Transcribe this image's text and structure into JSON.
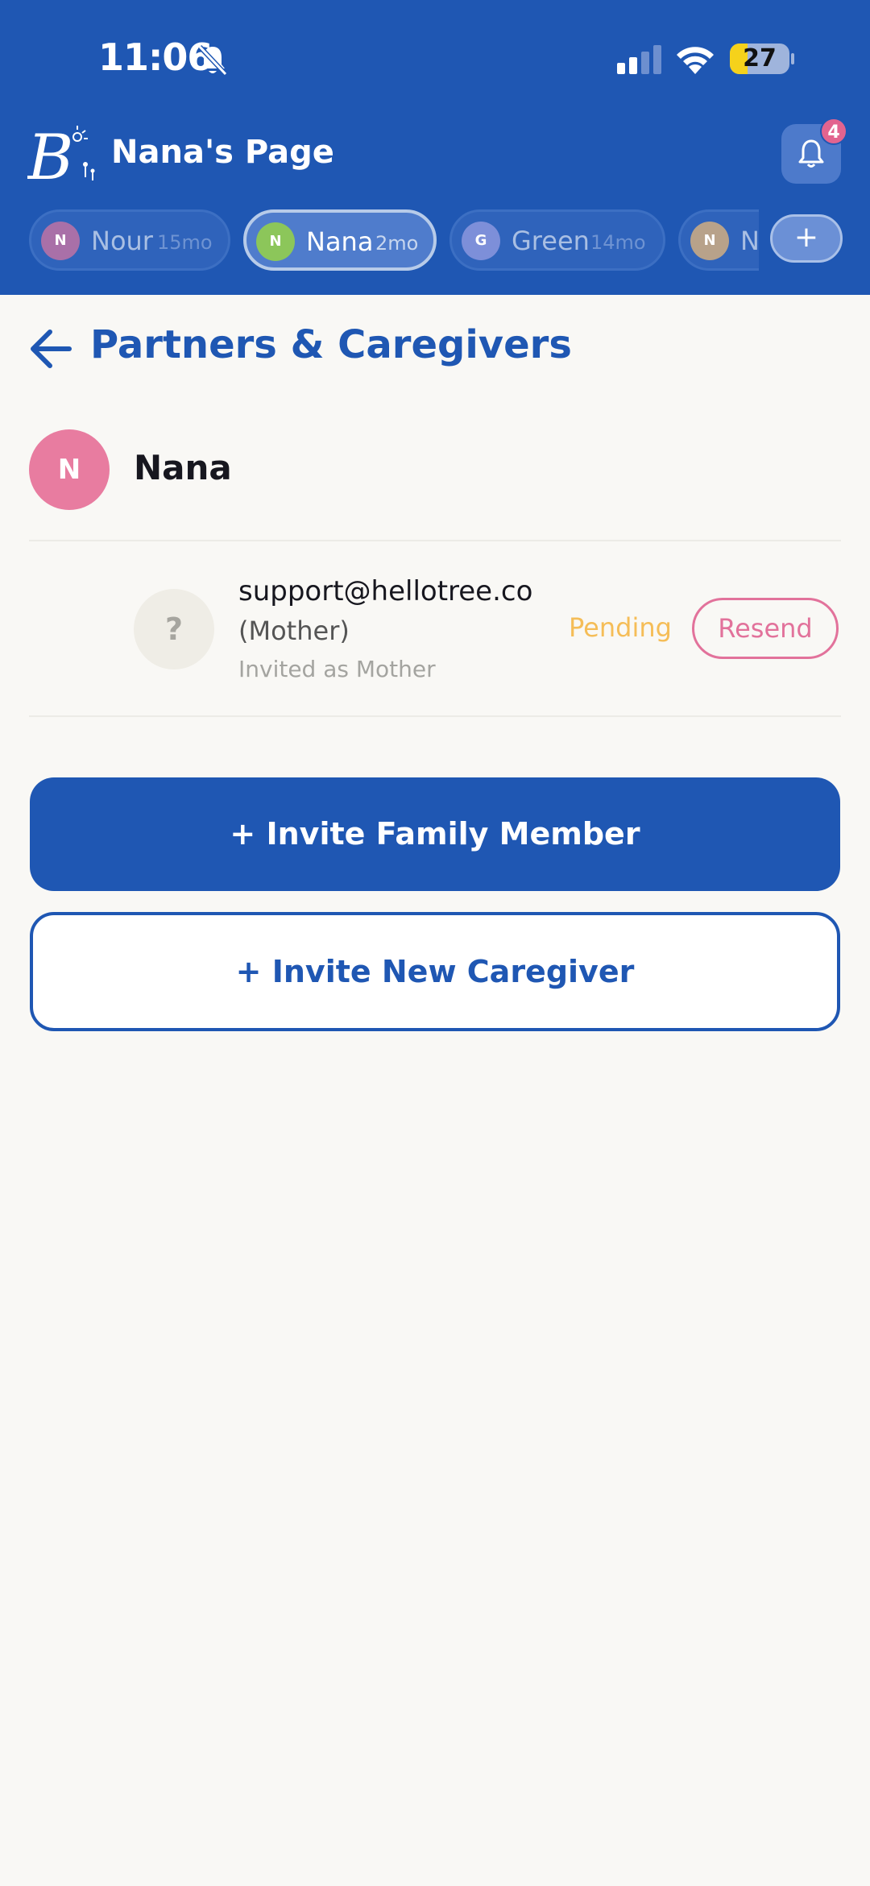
{
  "status_bar": {
    "time": "11:06",
    "battery": "27"
  },
  "header": {
    "title": "Nana's Page",
    "notification_count": "4",
    "children": [
      {
        "initial": "N",
        "name": "Nour",
        "age": "15mo",
        "color": "#a970a8",
        "active": false
      },
      {
        "initial": "N",
        "name": "Nana",
        "age": "2mo",
        "color": "#8cc65a",
        "active": true
      },
      {
        "initial": "G",
        "name": "Green",
        "age": "14mo",
        "color": "#7d8fd9",
        "active": false
      },
      {
        "initial": "N",
        "name": "Ne",
        "age": "",
        "color": "#b8a28a",
        "active": false
      }
    ],
    "add_label": "+"
  },
  "section": {
    "title": "Partners & Caregivers"
  },
  "baby": {
    "initial": "N",
    "name": "Nana"
  },
  "invites": [
    {
      "avatar": "?",
      "email": "support@hellotree.co",
      "relation": "(Mother)",
      "note": "Invited as Mother",
      "status": "Pending",
      "action": "Resend"
    }
  ],
  "actions": {
    "invite_family": "+ Invite Family Member",
    "invite_caregiver": "+ Invite New Caregiver"
  },
  "colors": {
    "brand": "#1f57b3",
    "pending": "#f5bd57",
    "resend": "#e2729b",
    "avatar_baby": "#e87ca0"
  }
}
